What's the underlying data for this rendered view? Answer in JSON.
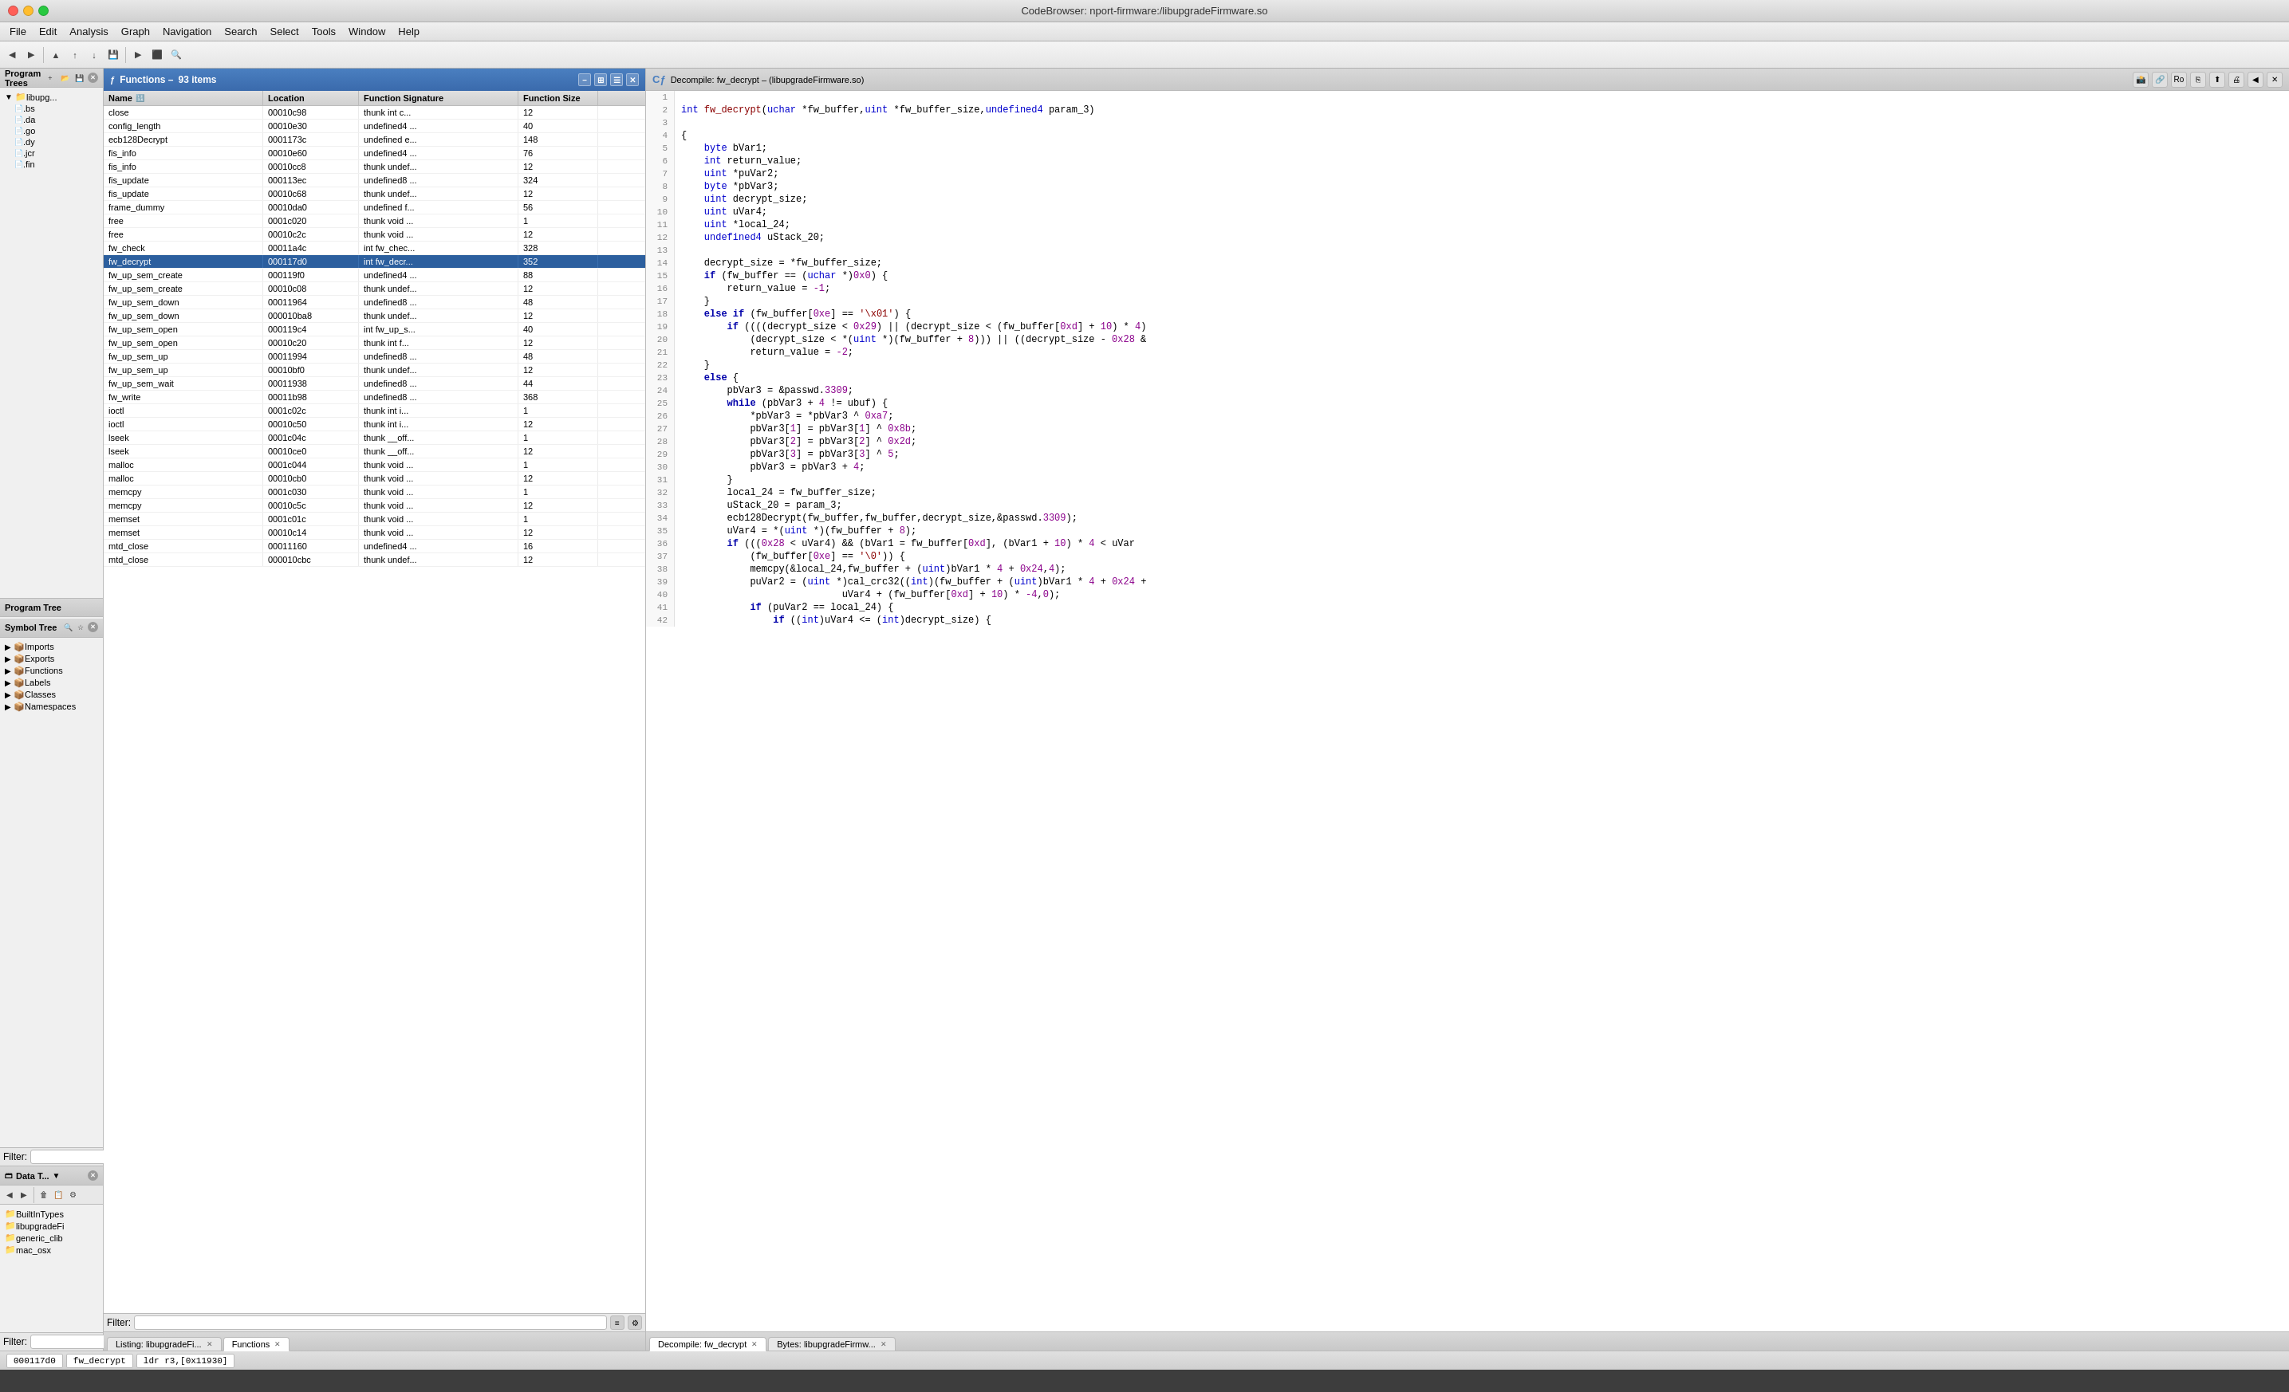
{
  "window": {
    "title": "CodeBrowser: nport-firmware:/libupgradeFirmware.so"
  },
  "menubar": {
    "items": [
      "File",
      "Edit",
      "Analysis",
      "Graph",
      "Navigation",
      "Search",
      "Select",
      "Tools",
      "Window",
      "Help"
    ]
  },
  "leftPanel": {
    "programTrees": {
      "label": "Program Trees",
      "root": "libupg...",
      "items": [
        {
          "indent": 0,
          "icon": "▶",
          "label": ".bs"
        },
        {
          "indent": 0,
          "icon": "",
          "label": ".da"
        },
        {
          "indent": 0,
          "icon": "",
          "label": ".go"
        },
        {
          "indent": 0,
          "icon": "",
          "label": ".dy"
        },
        {
          "indent": 0,
          "icon": "",
          "label": ".jcr"
        },
        {
          "indent": 0,
          "icon": "",
          "label": ".fin"
        }
      ],
      "sectionLabel": "Program Tree"
    },
    "symbolTree": {
      "label": "Symbol Tree",
      "items": [
        {
          "label": "Imports",
          "icon": "▶"
        },
        {
          "label": "Exports",
          "icon": "▶"
        },
        {
          "label": "Functions",
          "icon": "▶"
        },
        {
          "label": "Labels",
          "icon": "▶"
        },
        {
          "label": "Classes",
          "icon": "▶"
        },
        {
          "label": "Namespaces",
          "icon": "▶"
        }
      ]
    },
    "filterLabel": "Filter:",
    "dataTypes": {
      "label": "Data T...",
      "items": [
        {
          "label": "BuiltInTypes",
          "icon": "📁"
        },
        {
          "label": "libupgradeFi",
          "icon": "📁"
        },
        {
          "label": "generic_clib",
          "icon": "📁"
        },
        {
          "label": "mac_osx",
          "icon": "📁"
        }
      ]
    },
    "filterLabel2": "Filter:"
  },
  "functionsPanel": {
    "title": "Functions",
    "count": "93 items",
    "columns": [
      "Name",
      "Location",
      "Function Signature",
      "Function Size"
    ],
    "rows": [
      {
        "name": "close",
        "location": "00010c98",
        "signature": "thunk int c...",
        "size": "12"
      },
      {
        "name": "config_length",
        "location": "00010e30",
        "signature": "undefined4 ...",
        "size": "40"
      },
      {
        "name": "ecb128Decrypt",
        "location": "0001173c",
        "signature": "undefined e...",
        "size": "148"
      },
      {
        "name": "fis_info",
        "location": "00010e60",
        "signature": "undefined4 ...",
        "size": "76"
      },
      {
        "name": "fis_info",
        "location": "00010cc8",
        "signature": "thunk undef...",
        "size": "12"
      },
      {
        "name": "fis_update",
        "location": "000113ec",
        "signature": "undefined8 ...",
        "size": "324"
      },
      {
        "name": "fis_update",
        "location": "00010c68",
        "signature": "thunk undef...",
        "size": "12"
      },
      {
        "name": "frame_dummy",
        "location": "00010da0",
        "signature": "undefined f...",
        "size": "56"
      },
      {
        "name": "free",
        "location": "0001c020",
        "signature": "thunk void ...",
        "size": "1"
      },
      {
        "name": "free",
        "location": "00010c2c",
        "signature": "thunk void ...",
        "size": "12"
      },
      {
        "name": "fw_check",
        "location": "00011a4c",
        "signature": "int fw_chec...",
        "size": "328"
      },
      {
        "name": "fw_decrypt",
        "location": "000117d0",
        "signature": "int fw_decr...",
        "size": "352",
        "selected": true
      },
      {
        "name": "fw_up_sem_create",
        "location": "000119f0",
        "signature": "undefined4 ...",
        "size": "88"
      },
      {
        "name": "fw_up_sem_create",
        "location": "00010c08",
        "signature": "thunk undef...",
        "size": "12"
      },
      {
        "name": "fw_up_sem_down",
        "location": "00011964",
        "signature": "undefined8 ...",
        "size": "48"
      },
      {
        "name": "fw_up_sem_down",
        "location": "000010ba8",
        "signature": "thunk undef...",
        "size": "12"
      },
      {
        "name": "fw_up_sem_open",
        "location": "000119c4",
        "signature": "int fw_up_s...",
        "size": "40"
      },
      {
        "name": "fw_up_sem_open",
        "location": "00010c20",
        "signature": "thunk int f...",
        "size": "12"
      },
      {
        "name": "fw_up_sem_up",
        "location": "00011994",
        "signature": "undefined8 ...",
        "size": "48"
      },
      {
        "name": "fw_up_sem_up",
        "location": "00010bf0",
        "signature": "thunk undef...",
        "size": "12"
      },
      {
        "name": "fw_up_sem_wait",
        "location": "00011938",
        "signature": "undefined8 ...",
        "size": "44"
      },
      {
        "name": "fw_write",
        "location": "00011b98",
        "signature": "undefined8 ...",
        "size": "368"
      },
      {
        "name": "ioctl",
        "location": "0001c02c",
        "signature": "thunk int i...",
        "size": "1"
      },
      {
        "name": "ioctl",
        "location": "00010c50",
        "signature": "thunk int i...",
        "size": "12"
      },
      {
        "name": "lseek",
        "location": "0001c04c",
        "signature": "thunk __off...",
        "size": "1"
      },
      {
        "name": "lseek",
        "location": "00010ce0",
        "signature": "thunk __off...",
        "size": "12"
      },
      {
        "name": "malloc",
        "location": "0001c044",
        "signature": "thunk void ...",
        "size": "1"
      },
      {
        "name": "malloc",
        "location": "00010cb0",
        "signature": "thunk void ...",
        "size": "12"
      },
      {
        "name": "memcpy",
        "location": "0001c030",
        "signature": "thunk void ...",
        "size": "1"
      },
      {
        "name": "memcpy",
        "location": "00010c5c",
        "signature": "thunk void ...",
        "size": "12"
      },
      {
        "name": "memset",
        "location": "0001c01c",
        "signature": "thunk void ...",
        "size": "1"
      },
      {
        "name": "memset",
        "location": "00010c14",
        "signature": "thunk void ...",
        "size": "12"
      },
      {
        "name": "mtd_close",
        "location": "00011160",
        "signature": "undefined4 ...",
        "size": "16"
      },
      {
        "name": "mtd_close",
        "location": "000010cbc",
        "signature": "thunk undef...",
        "size": "12"
      }
    ],
    "filterLabel": "Filter:"
  },
  "decompiler": {
    "title": "Decompile: fw_decrypt",
    "subtitle": "(libupgradeFirmware.so)",
    "lines": [
      {
        "num": 1,
        "content": ""
      },
      {
        "num": 2,
        "content": "int fw_decrypt(uchar *fw_buffer,uint *fw_buffer_size,undefined4 param_3)"
      },
      {
        "num": 3,
        "content": ""
      },
      {
        "num": 4,
        "content": "{"
      },
      {
        "num": 5,
        "content": "    byte bVar1;"
      },
      {
        "num": 6,
        "content": "    int return_value;"
      },
      {
        "num": 7,
        "content": "    uint *puVar2;"
      },
      {
        "num": 8,
        "content": "    byte *pbVar3;"
      },
      {
        "num": 9,
        "content": "    uint decrypt_size;"
      },
      {
        "num": 10,
        "content": "    uint uVar4;"
      },
      {
        "num": 11,
        "content": "    uint *local_24;"
      },
      {
        "num": 12,
        "content": "    undefined4 uStack_20;"
      },
      {
        "num": 13,
        "content": ""
      },
      {
        "num": 14,
        "content": "    decrypt_size = *fw_buffer_size;"
      },
      {
        "num": 15,
        "content": "    if (fw_buffer == (uchar *)0x0) {"
      },
      {
        "num": 16,
        "content": "        return_value = -1;"
      },
      {
        "num": 17,
        "content": "    }"
      },
      {
        "num": 18,
        "content": "    else if (fw_buffer[0xe] == '\\x01') {"
      },
      {
        "num": 19,
        "content": "        if ((((decrypt_size < 0x29) || (decrypt_size < (fw_buffer[0xd] + 10) * 4)"
      },
      {
        "num": 20,
        "content": "            (decrypt_size < *(uint *)(fw_buffer + 8))) || ((decrypt_size - 0x28 &"
      },
      {
        "num": 21,
        "content": "            return_value = -2;"
      },
      {
        "num": 22,
        "content": "    }"
      },
      {
        "num": 23,
        "content": "    else {"
      },
      {
        "num": 24,
        "content": "        pbVar3 = &passwd.3309;"
      },
      {
        "num": 25,
        "content": "        while (pbVar3 + 4 != ubuf) {"
      },
      {
        "num": 26,
        "content": "            *pbVar3 = *pbVar3 ^ 0xa7;"
      },
      {
        "num": 27,
        "content": "            pbVar3[1] = pbVar3[1] ^ 0x8b;"
      },
      {
        "num": 28,
        "content": "            pbVar3[2] = pbVar3[2] ^ 0x2d;"
      },
      {
        "num": 29,
        "content": "            pbVar3[3] = pbVar3[3] ^ 5;"
      },
      {
        "num": 30,
        "content": "            pbVar3 = pbVar3 + 4;"
      },
      {
        "num": 31,
        "content": "        }"
      },
      {
        "num": 32,
        "content": "        local_24 = fw_buffer_size;"
      },
      {
        "num": 33,
        "content": "        uStack_20 = param_3;"
      },
      {
        "num": 34,
        "content": "        ecb128Decrypt(fw_buffer,fw_buffer,decrypt_size,&passwd.3309);"
      },
      {
        "num": 35,
        "content": "        uVar4 = *(uint *)(fw_buffer + 8);"
      },
      {
        "num": 36,
        "content": "        if (((0x28 < uVar4) && (bVar1 = fw_buffer[0xd], (bVar1 + 10) * 4 < uVar"
      },
      {
        "num": 37,
        "content": "            (fw_buffer[0xe] == '\\0')) {"
      },
      {
        "num": 38,
        "content": "            memcpy(&local_24,fw_buffer + (uint)bVar1 * 4 + 0x24,4);"
      },
      {
        "num": 39,
        "content": "            puVar2 = (uint *)cal_crc32((int)(fw_buffer + (uint)bVar1 * 4 + 0x24 +"
      },
      {
        "num": 40,
        "content": "                            uVar4 + (fw_buffer[0xd] + 10) * -4,0);"
      },
      {
        "num": 41,
        "content": "            if (puVar2 == local_24) {"
      },
      {
        "num": 42,
        "content": "                if ((int)uVar4 <= (int)decrypt_size) {"
      }
    ]
  },
  "bottomTabs": {
    "left": [
      {
        "label": "Listing: libupgradeFi...",
        "active": false
      },
      {
        "label": "Functions",
        "active": true
      }
    ],
    "right": [
      {
        "label": "Decompile: fw_decrypt",
        "active": true
      },
      {
        "label": "Bytes: libupgradeFirmw...",
        "active": false
      }
    ]
  },
  "statusbar": {
    "address": "000117d0",
    "symbol": "fw_decrypt",
    "instruction": "ldr r3,[0x11930]"
  }
}
